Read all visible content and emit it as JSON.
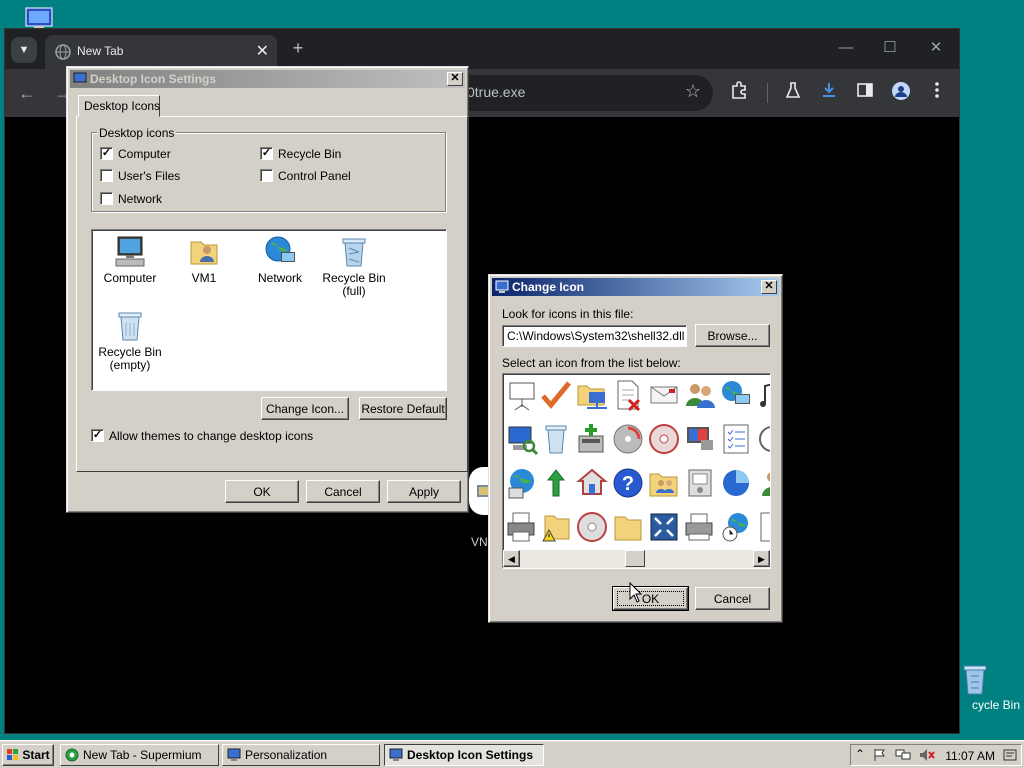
{
  "desktop": {
    "recycle_bin_label": "cycle Bin"
  },
  "browser": {
    "tab_title": "New Tab",
    "tab_close": "✕",
    "new_tab": "+",
    "minimize": "—",
    "maximize": "☐",
    "close": "✕",
    "back": "←",
    "forward": "→",
    "url_fragment": "0true.exe",
    "star": "☆",
    "content_label": "VN"
  },
  "desktop_icon_settings": {
    "title": "Desktop Icon Settings",
    "close": "✕",
    "tab_label": "Desktop Icons",
    "group_label": "Desktop icons",
    "checkboxes": [
      {
        "label": "Computer",
        "checked": true,
        "mark": "✓"
      },
      {
        "label": "Recycle Bin",
        "checked": true,
        "mark": "✓"
      },
      {
        "label": "User's Files",
        "checked": false,
        "mark": ""
      },
      {
        "label": "Control Panel",
        "checked": false,
        "mark": ""
      },
      {
        "label": "Network",
        "checked": false,
        "mark": ""
      }
    ],
    "icons": [
      {
        "label": "Computer",
        "icon": "computer-icon"
      },
      {
        "label": "VM1",
        "icon": "user-folder-icon"
      },
      {
        "label": "Network",
        "icon": "network-icon"
      },
      {
        "label": "Recycle Bin\n(full)",
        "icon": "recycle-bin-full-icon"
      },
      {
        "label": "Recycle Bin\n(empty)",
        "icon": "recycle-bin-empty-icon"
      }
    ],
    "change_icon_button": "Change Icon...",
    "restore_default_button": "Restore Default",
    "allow_themes_label": "Allow themes to change desktop icons",
    "allow_themes_checked": true,
    "allow_themes_mark": "✓",
    "ok_button": "OK",
    "cancel_button": "Cancel",
    "apply_button": "Apply"
  },
  "change_icon": {
    "title": "Change Icon",
    "close": "✕",
    "look_for_label": "Look for icons in this file:",
    "file_value": "C:\\Windows\\System32\\shell32.dll",
    "browse_button": "Browse...",
    "select_label": "Select an icon from the list below:",
    "scroll_left": "◀",
    "scroll_right": "▶",
    "ok_button": "OK",
    "cancel_button": "Cancel"
  },
  "taskbar": {
    "start_label": "Start",
    "tasks": [
      {
        "label": "New Tab - Supermium",
        "active": false
      },
      {
        "label": "Personalization",
        "active": false
      },
      {
        "label": "Desktop Icon Settings",
        "active": true
      }
    ],
    "tray_expand": "⌃",
    "clock": "11:07 AM"
  }
}
